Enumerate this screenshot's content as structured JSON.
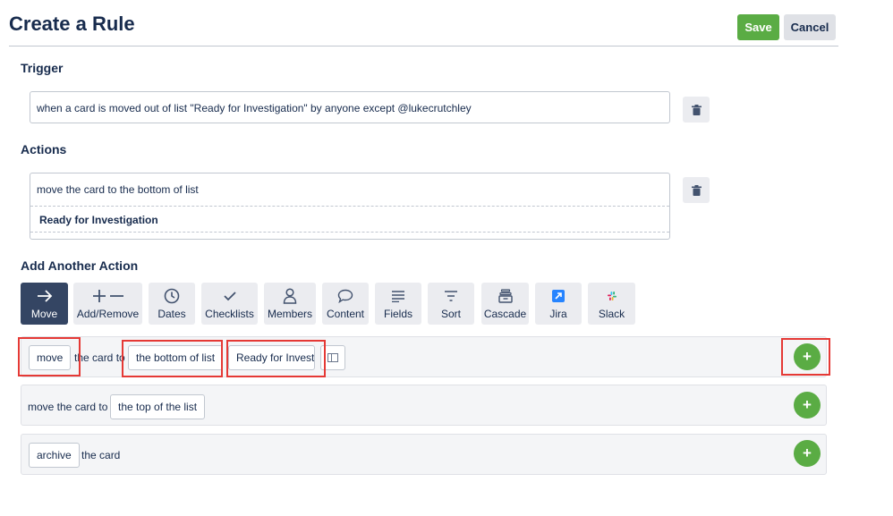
{
  "header": {
    "title": "Create a Rule",
    "save_label": "Save",
    "cancel_label": "Cancel"
  },
  "trigger": {
    "heading": "Trigger",
    "text": "when a card is moved out of list \"Ready for Investigation\" by anyone except @lukecrutchley"
  },
  "actions": {
    "heading": "Actions",
    "action_text": "move the card to the bottom of list",
    "list_name": "Ready for Investigation"
  },
  "add_action": {
    "heading": "Add Another Action",
    "categories": [
      {
        "label": "Move",
        "icon": "arrow-right-icon",
        "active": true
      },
      {
        "label": "Add/Remove",
        "icon": "plus-minus-icon"
      },
      {
        "label": "Dates",
        "icon": "clock-icon"
      },
      {
        "label": "Checklists",
        "icon": "checkmark-icon"
      },
      {
        "label": "Members",
        "icon": "person-icon"
      },
      {
        "label": "Content",
        "icon": "speech-bubble-icon"
      },
      {
        "label": "Fields",
        "icon": "lines-icon"
      },
      {
        "label": "Sort",
        "icon": "filter-icon"
      },
      {
        "label": "Cascade",
        "icon": "archive-box-icon"
      },
      {
        "label": "Jira",
        "icon": "jira-icon"
      },
      {
        "label": "Slack",
        "icon": "slack-icon"
      }
    ],
    "options": [
      {
        "verb": "move",
        "mid": "the card to",
        "position": "the bottom of list",
        "list_value": "Ready for Investigation"
      },
      {
        "text": "move the card to",
        "position": "the top of the list"
      },
      {
        "verb": "archive",
        "text": "the card"
      }
    ]
  },
  "colors": {
    "accent_green": "#5aac44",
    "highlight_red": "#e53935",
    "text_dark": "#172b4d",
    "active_tile": "#344563"
  }
}
